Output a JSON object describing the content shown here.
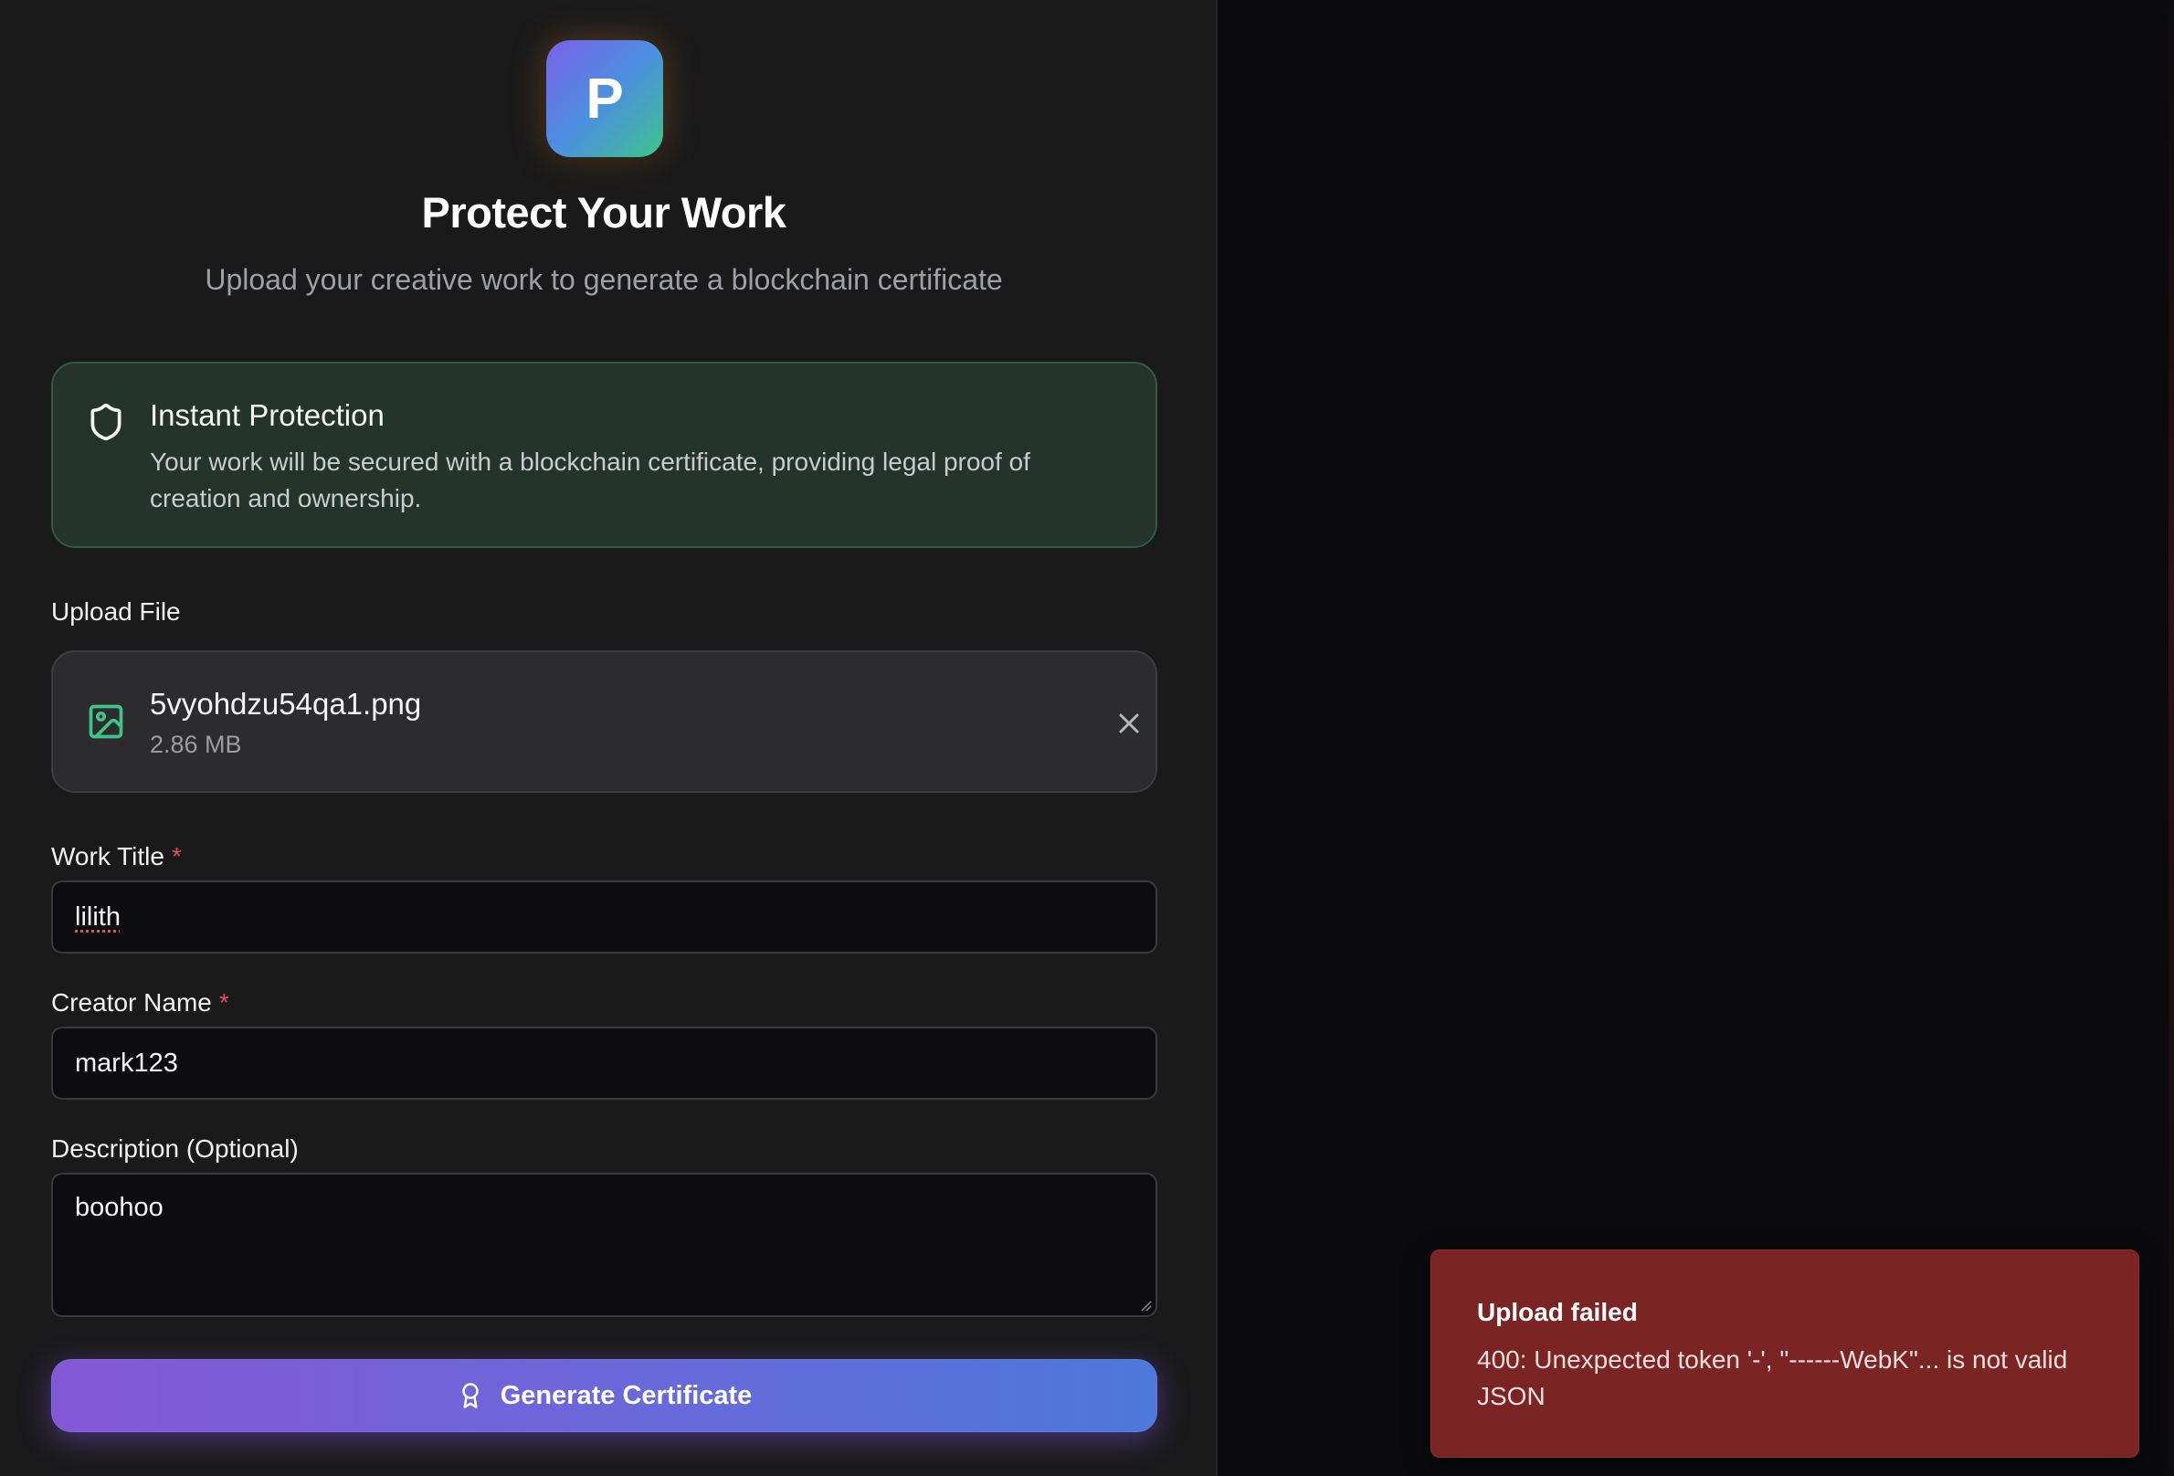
{
  "logo": {
    "letter": "P"
  },
  "header": {
    "title": "Protect Your Work",
    "subtitle": "Upload your creative work to generate a blockchain certificate"
  },
  "info": {
    "icon": "shield-icon",
    "title": "Instant Protection",
    "text": "Your work will be secured with a blockchain certificate, providing legal proof of creation and ownership."
  },
  "upload": {
    "label": "Upload File",
    "file_icon": "image-icon",
    "file_name": "5vyohdzu54qa1.png",
    "file_size": "2.86 MB",
    "remove_icon": "close-icon"
  },
  "form": {
    "work_title": {
      "label": "Work Title",
      "required_mark": "*",
      "value": "lilith"
    },
    "creator_name": {
      "label": "Creator Name",
      "required_mark": "*",
      "value": "mark123"
    },
    "description": {
      "label": "Description (Optional)",
      "value": "boohoo"
    }
  },
  "submit": {
    "icon": "award-icon",
    "label": "Generate Certificate"
  },
  "toast": {
    "title": "Upload failed",
    "message": "400: Unexpected token '-', \"------WebK\"... is not valid JSON"
  },
  "colors": {
    "accent_start": "#8457d6",
    "accent_end": "#4d78dc",
    "success": "#3fc48a",
    "error_bg": "#7a2424",
    "required": "#e05252"
  }
}
